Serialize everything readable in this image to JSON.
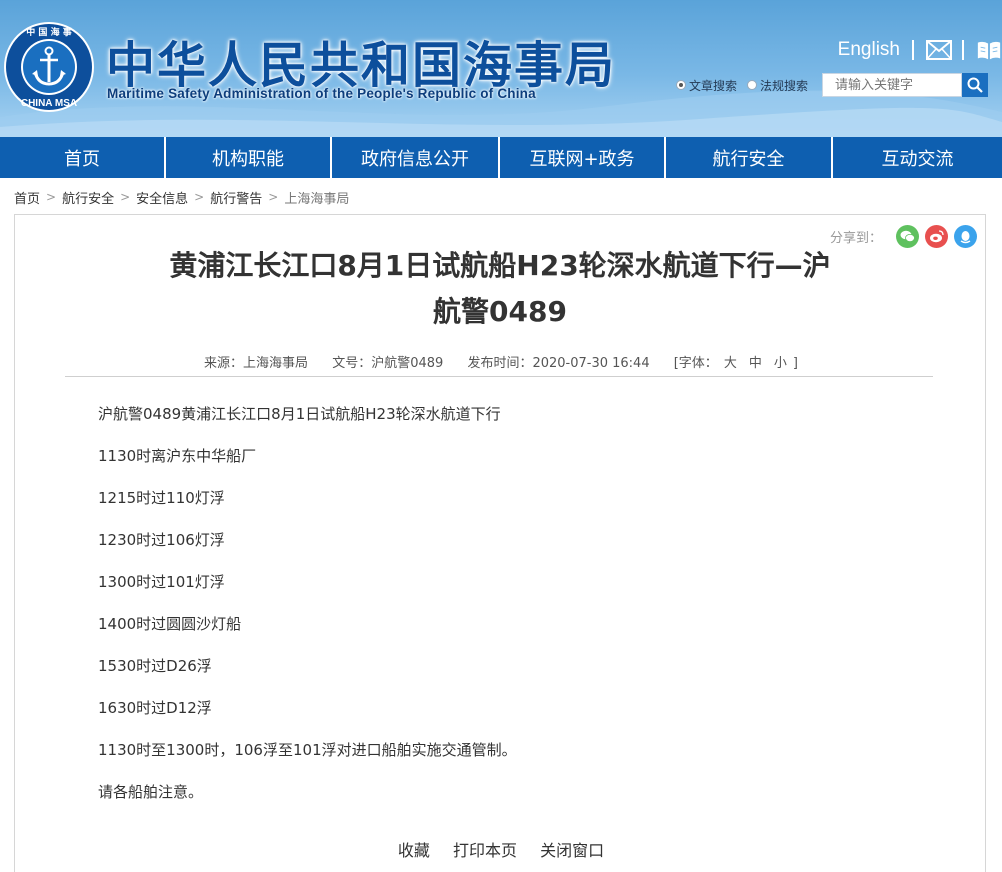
{
  "header": {
    "title": "中华人民共和国海事局",
    "subtitle": "Maritime Safety Administration of the People's Republic of China",
    "logo": {
      "top_text": "中国海事",
      "bottom_text": "CHINA MSA"
    },
    "english_link": "English",
    "mail_icon": "mail-icon",
    "book_icon": "book-icon",
    "search": {
      "options": [
        "文章搜索",
        "法规搜索"
      ],
      "selected": "文章搜索",
      "placeholder": "请输入关键字",
      "button_icon": "search-icon"
    }
  },
  "nav": {
    "items": [
      "首页",
      "机构职能",
      "政府信息公开",
      "互联网+政务",
      "航行安全",
      "互动交流"
    ]
  },
  "breadcrumb": [
    "首页",
    "航行安全",
    "安全信息",
    "航行警告",
    "上海海事局"
  ],
  "share": {
    "label": "分享到：",
    "icons": [
      "wechat-icon",
      "weibo-icon",
      "qq-icon"
    ]
  },
  "article": {
    "title_line1": "黄浦江长江口8月1日试航船H23轮深水航道下行—沪",
    "title_line2": "航警0489",
    "meta": {
      "source": "来源：上海海事局",
      "doc_no": "文号：沪航警0489",
      "published": "发布时间：2020-07-30 16:44",
      "font_label": "[字体：",
      "font_sizes": [
        "大",
        "中",
        "小"
      ],
      "font_close": "]"
    },
    "paragraphs": [
      "沪航警0489黄浦江长江口8月1日试航船H23轮深水航道下行",
      "1130时离沪东中华船厂",
      "1215时过110灯浮",
      "1230时过106灯浮",
      "1300时过101灯浮",
      "1400时过圆圆沙灯船",
      "1530时过D26浮",
      "1630时过D12浮",
      "1130时至1300时，106浮至101浮对进口船舶实施交通管制。",
      "请各船舶注意。"
    ]
  },
  "footer_links": [
    "收藏",
    "打印本页",
    "关闭窗口"
  ],
  "colors": {
    "nav_bg": "#0e5fb0",
    "title_blue": "#0d4f9c",
    "header_sky": "#7ab8e6",
    "wechat": "#5fc15f",
    "weibo": "#e8504f",
    "qq": "#3ba3ec"
  }
}
